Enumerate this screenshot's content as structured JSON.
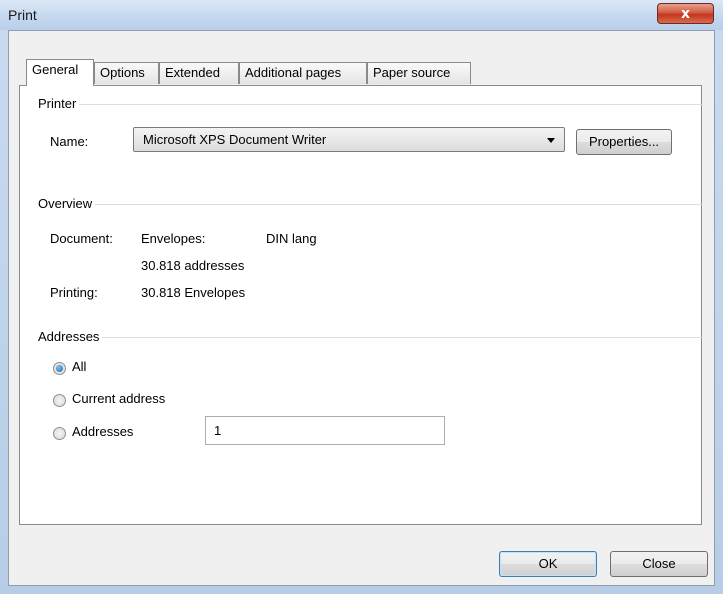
{
  "window": {
    "title": "Print",
    "close_glyph": "x"
  },
  "tabs": [
    {
      "label": "General",
      "active": true
    },
    {
      "label": "Options",
      "active": false
    },
    {
      "label": "Extended",
      "active": false
    },
    {
      "label": "Additional pages",
      "active": false
    },
    {
      "label": "Paper source",
      "active": false
    }
  ],
  "printer": {
    "group_label": "Printer",
    "name_label": "Name:",
    "name_value": "Microsoft XPS Document Writer",
    "properties_label": "Properties..."
  },
  "overview": {
    "group_label": "Overview",
    "document_label": "Document:",
    "envelopes_label": "Envelopes:",
    "envelope_format": "DIN lang",
    "addresses_count": "30.818 addresses",
    "printing_label": "Printing:",
    "printing_value": "30.818 Envelopes"
  },
  "addresses": {
    "group_label": "Addresses",
    "options": [
      {
        "label": "All",
        "checked": true
      },
      {
        "label": "Current address",
        "checked": false
      },
      {
        "label": "Addresses",
        "checked": false
      }
    ],
    "range_value": "1"
  },
  "footer": {
    "ok_label": "OK",
    "close_label": "Close"
  },
  "colors": {
    "accent": "#3c7fb1",
    "close_red": "#c2361c",
    "titlebar": "#c4d8ee"
  }
}
